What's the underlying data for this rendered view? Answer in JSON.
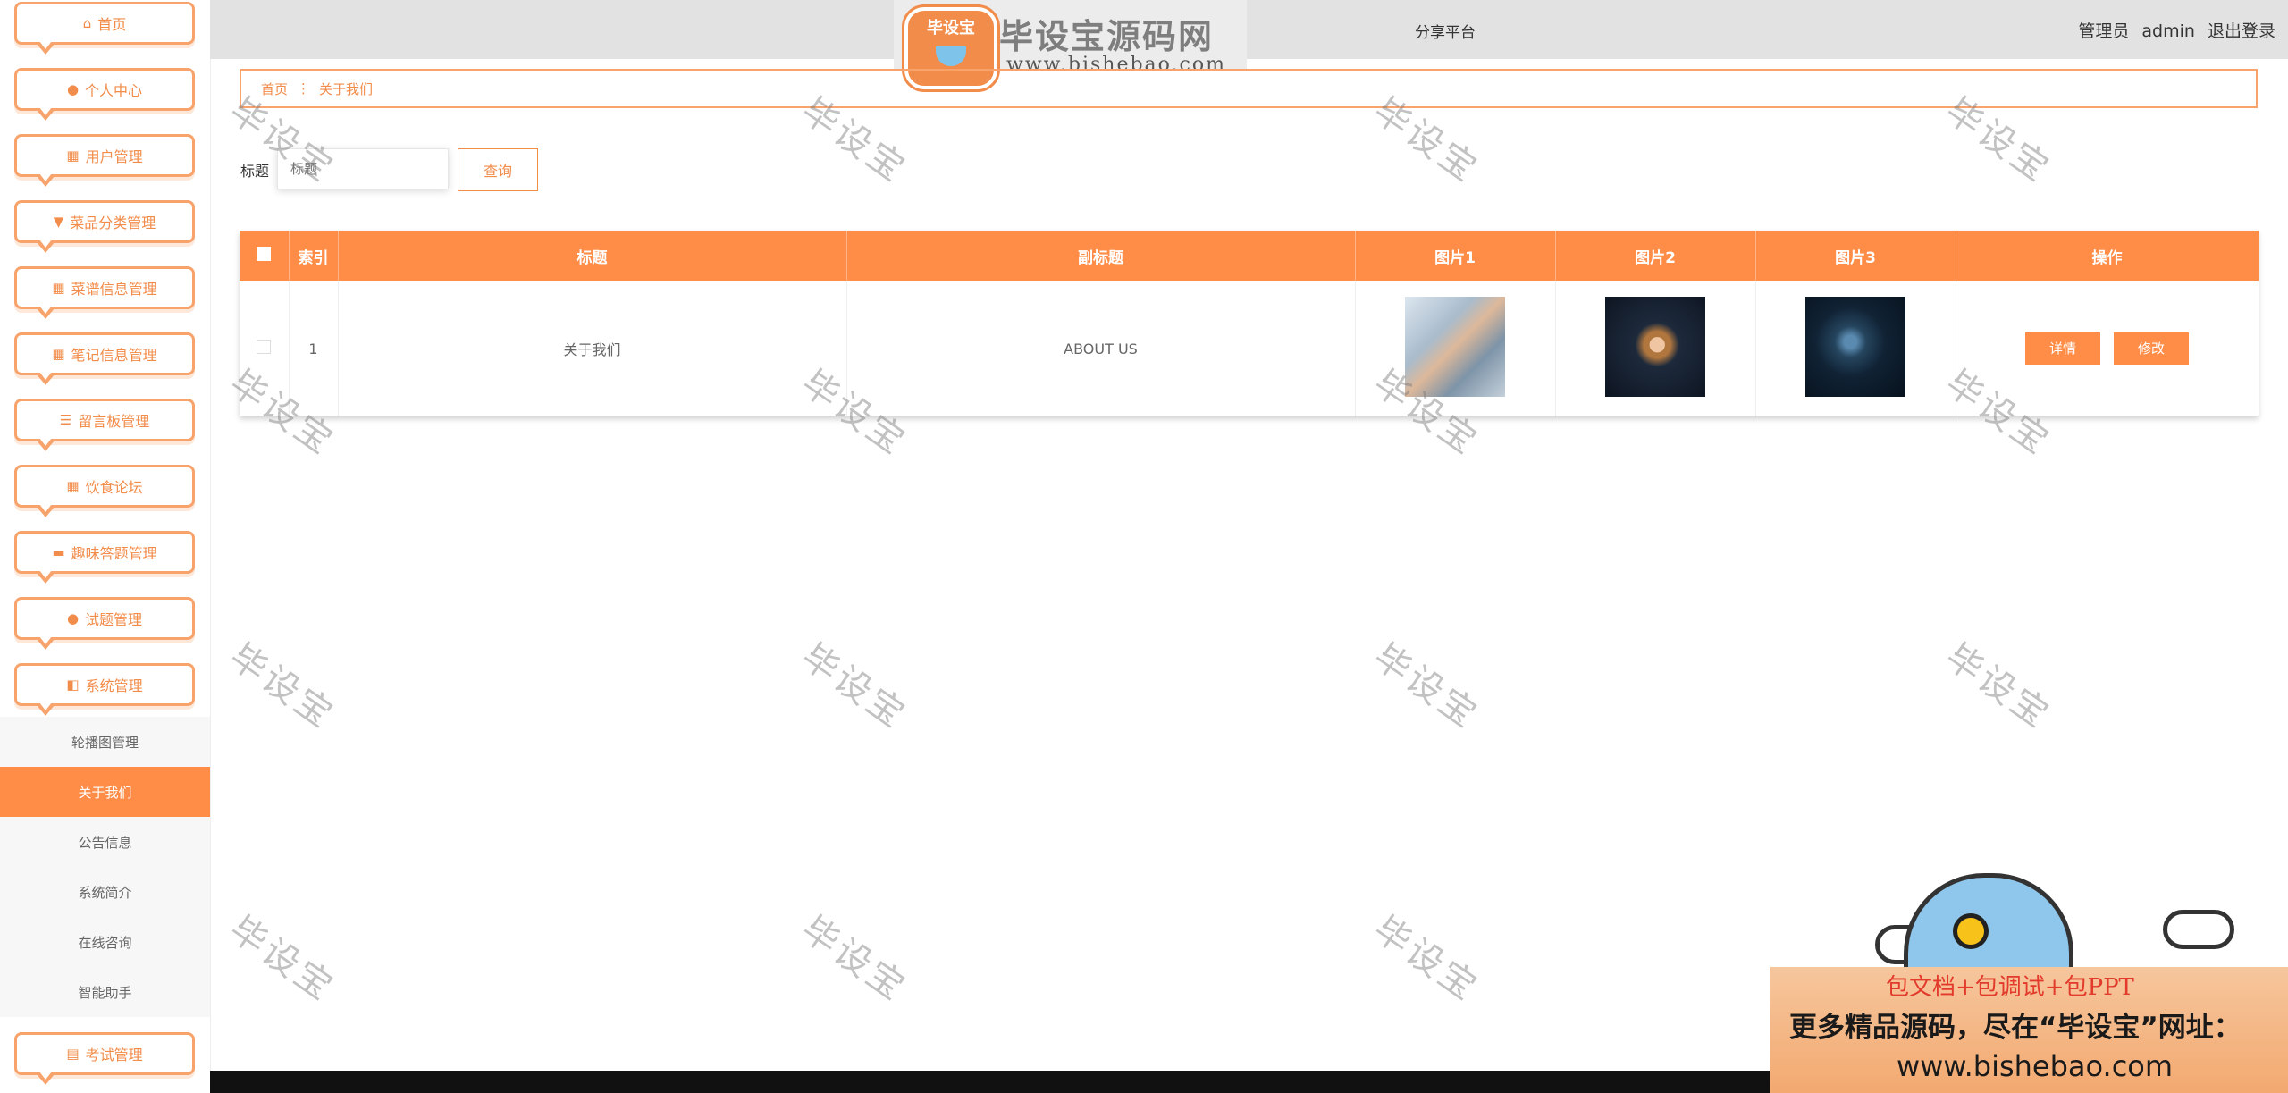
{
  "sidebar": {
    "menu": [
      {
        "label": "首页",
        "icon": "home-icon",
        "glyph": "⌂"
      },
      {
        "label": "个人中心",
        "icon": "user-icon",
        "glyph": "●"
      },
      {
        "label": "用户管理",
        "icon": "chart-icon",
        "glyph": "▦"
      },
      {
        "label": "菜品分类管理",
        "icon": "pin-icon",
        "glyph": "▼"
      },
      {
        "label": "菜谱信息管理",
        "icon": "grid-icon",
        "glyph": "▦"
      },
      {
        "label": "笔记信息管理",
        "icon": "grid-icon",
        "glyph": "▦"
      },
      {
        "label": "留言板管理",
        "icon": "sliders-icon",
        "glyph": "☰"
      },
      {
        "label": "饮食论坛",
        "icon": "grid-icon",
        "glyph": "▦"
      },
      {
        "label": "趣味答题管理",
        "icon": "briefcase-icon",
        "glyph": "▬"
      },
      {
        "label": "试题管理",
        "icon": "user-icon",
        "glyph": "●"
      },
      {
        "label": "系统管理",
        "icon": "system-icon",
        "glyph": "◧"
      }
    ],
    "submenu": [
      {
        "label": "轮播图管理",
        "active": false
      },
      {
        "label": "关于我们",
        "active": true
      },
      {
        "label": "公告信息",
        "active": false
      },
      {
        "label": "系统简介",
        "active": false
      },
      {
        "label": "在线咨询",
        "active": false
      },
      {
        "label": "智能助手",
        "active": false
      }
    ],
    "bottom_item": {
      "label": "考试管理",
      "icon": "clipboard-icon",
      "glyph": "▤"
    }
  },
  "header": {
    "logo_badge": "毕设宝",
    "logo_title": "毕设宝源码网",
    "logo_url": "www.bishebao.com",
    "platform_title": "分享平台",
    "user_role": "管理员",
    "username": "admin",
    "logout": "退出登录"
  },
  "breadcrumb": {
    "home": "首页",
    "separator": "⋮",
    "current": "关于我们"
  },
  "search": {
    "label": "标题",
    "placeholder": "标题",
    "button": "查询"
  },
  "table": {
    "columns": [
      "",
      "索引",
      "标题",
      "副标题",
      "图片1",
      "图片2",
      "图片3",
      "操作"
    ],
    "rows": [
      {
        "index": "1",
        "title": "关于我们",
        "subtitle": "ABOUT US",
        "detail": "详情",
        "edit": "修改"
      }
    ]
  },
  "watermark": "毕设宝",
  "promo": {
    "line1": "包文档+包调试+包PPT",
    "line2": "更多精品源码，尽在“毕设宝”网址：",
    "line3": "www.bishebao.com"
  },
  "colors": {
    "accent": "#ff8c47",
    "accent_border": "#f7a36b",
    "topbar": "#e2e2e2"
  }
}
